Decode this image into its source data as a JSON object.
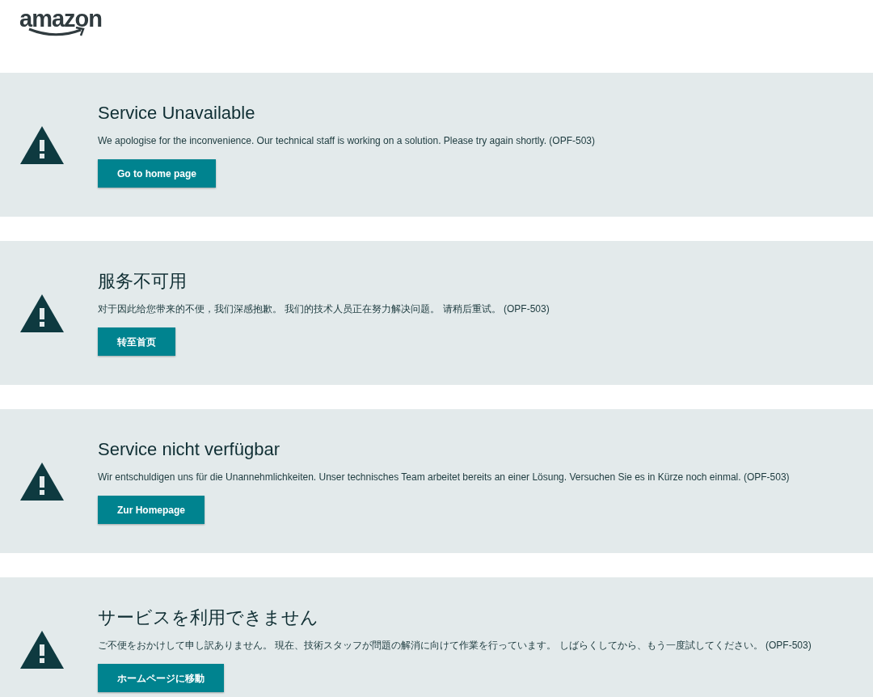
{
  "logo": {
    "text": "amazon"
  },
  "notices": [
    {
      "title": "Service Unavailable",
      "message": "We apologise for the inconvenience. Our technical staff is working on a solution. Please try again shortly. (OPF-503)",
      "button": "Go to home page"
    },
    {
      "title": "服务不可用",
      "message": "对于因此给您带来的不便，我们深感抱歉。 我们的技术人员正在努力解决问题。 请稍后重试。 (OPF-503)",
      "button": "转至首页"
    },
    {
      "title": "Service nicht verfügbar",
      "message": "Wir entschuldigen uns für die Unannehmlichkeiten. Unser technisches Team arbeitet bereits an einer Lösung. Versuchen Sie es in Kürze noch einmal. (OPF-503)",
      "button": "Zur Homepage"
    },
    {
      "title": "サービスを利用できません",
      "message": "ご不便をおかけして申し訳ありません。 現在、技術スタッフが問題の解消に向けて作業を行っています。 しばらくしてから、もう一度試してください。 (OPF-503)",
      "button": "ホームページに移動"
    }
  ]
}
